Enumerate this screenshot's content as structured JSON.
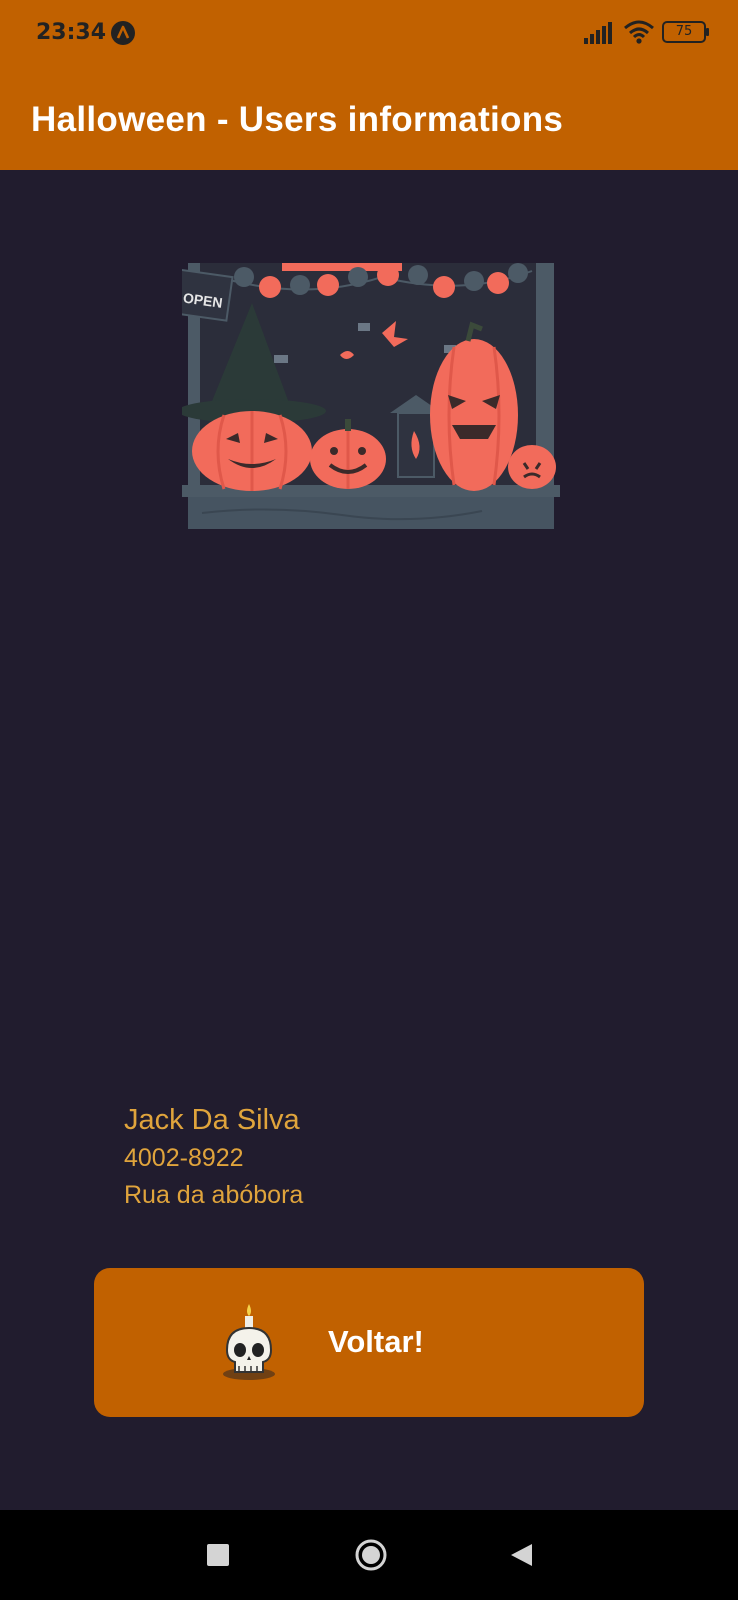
{
  "status_bar": {
    "time": "23:34",
    "app_icon": "launcher-a-icon",
    "signal_icon": "cell-signal-icon",
    "wifi_icon": "wifi-icon",
    "battery_level": "75"
  },
  "app_bar": {
    "title": "Halloween - Users informations"
  },
  "hero_image": {
    "sign_text": "OPEN",
    "description_icon": "halloween-pumpkins-shop-illustration"
  },
  "user": {
    "name": "Jack Da Silva",
    "phone": "4002-8922",
    "address": "Rua da abóbora"
  },
  "back_button": {
    "label": "Voltar!",
    "icon": "skull-candle-icon"
  },
  "nav_bar": {
    "recents_icon": "square-recents-icon",
    "home_icon": "circle-home-icon",
    "back_icon": "triangle-back-icon"
  },
  "colors": {
    "primary": "#c16100",
    "background": "#211c2e",
    "user_text": "#e0a43c"
  }
}
